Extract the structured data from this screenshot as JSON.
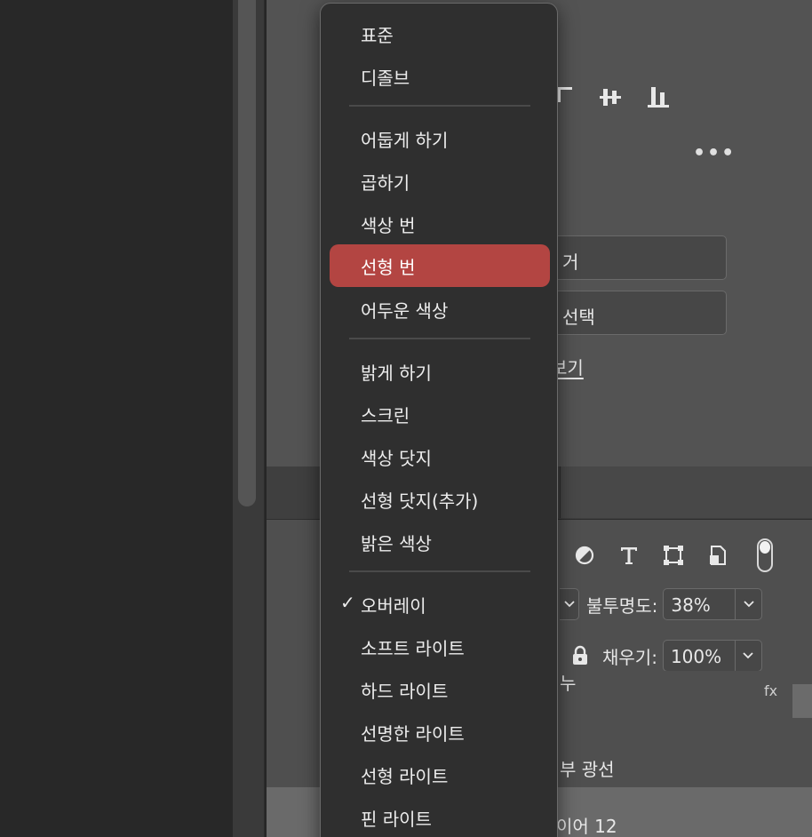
{
  "panel": {
    "field1_text": "거",
    "field2_text": "선택",
    "link_text": "보기",
    "more_label": "•••",
    "opacity_label": "불투명도:",
    "opacity_value": "38%",
    "fill_label": "채우기:",
    "fill_value": "100%",
    "layers": [
      {
        "label": "누"
      },
      {
        "label": "부 광선"
      },
      {
        "label": "이어 12"
      }
    ],
    "fx_label": "fx"
  },
  "blend_menu": {
    "selected": "오버레이",
    "highlighted": "선형 번",
    "groups": [
      [
        "표준",
        "디졸브"
      ],
      [
        "어둡게 하기",
        "곱하기",
        "색상 번",
        "선형 번",
        "어두운 색상"
      ],
      [
        "밝게 하기",
        "스크린",
        "색상 닷지",
        "선형 닷지(추가)",
        "밝은 색상"
      ],
      [
        "오버레이",
        "소프트 라이트",
        "하드 라이트",
        "선명한 라이트",
        "선형 라이트",
        "핀 라이트"
      ]
    ]
  },
  "colors": {
    "highlight": "#b34542",
    "menu_bg": "#2f2f2f",
    "panel_bg": "#535353"
  }
}
